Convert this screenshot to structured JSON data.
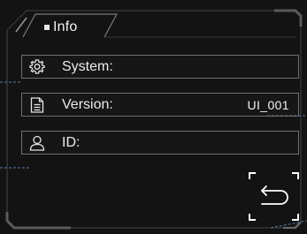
{
  "header": {
    "tab_label": "Info"
  },
  "rows": [
    {
      "label": "System:",
      "value": "",
      "icon": "gear-icon"
    },
    {
      "label": "Version:",
      "value": "UI_001",
      "icon": "document-icon"
    },
    {
      "label": "ID:",
      "value": "",
      "icon": "user-icon"
    }
  ],
  "back_button": {
    "icon": "return-arrow-icon"
  },
  "colors": {
    "background": "#131313",
    "frame": "#8a8a8a",
    "accent_dashed": "#5a7fa8",
    "text": "#ececec"
  }
}
